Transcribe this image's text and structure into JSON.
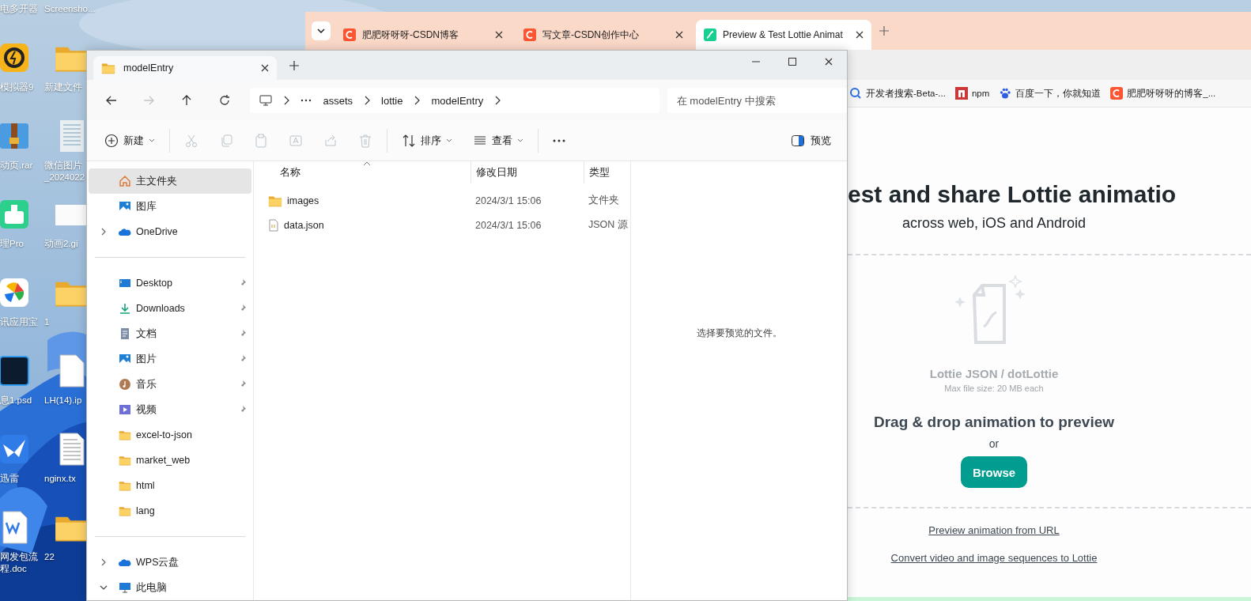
{
  "desktop": {
    "icons": [
      {
        "label": "电多开器",
        "kind": "none"
      },
      {
        "label": "Screensho...",
        "kind": "none"
      },
      {
        "label": "模拟器9",
        "kind": "emulator"
      },
      {
        "label": "新建文件",
        "kind": "folder"
      },
      {
        "label": "动页.rar",
        "kind": "archive"
      },
      {
        "label": "微信图片\n_2024022",
        "kind": "textimage"
      },
      {
        "label": "理Pro",
        "kind": "cleaner"
      },
      {
        "label": "动画2.gi",
        "kind": "blank"
      },
      {
        "label": "讯应用宝",
        "kind": "store"
      },
      {
        "label": "1",
        "kind": "folder"
      },
      {
        "label": "息1.psd",
        "kind": "psd"
      },
      {
        "label": "LH(14).ip",
        "kind": "file"
      },
      {
        "label": "迅雷",
        "kind": "bird"
      },
      {
        "label": "nginx.tx",
        "kind": "textfile"
      },
      {
        "label": "网发包流程.doc",
        "kind": "doc"
      },
      {
        "label": "22",
        "kind": "folder"
      }
    ]
  },
  "browser": {
    "tabs": [
      {
        "title": "肥肥呀呀呀-CSDN博客",
        "kind": "csdn",
        "selected": false
      },
      {
        "title": "写文章-CSDN创作中心",
        "kind": "csdn",
        "selected": false
      },
      {
        "title": "Preview & Test Lottie Animat",
        "kind": "lottie",
        "selected": true
      }
    ],
    "bookmarks": [
      {
        "label": "开发者搜索-Beta-...",
        "kind": "search"
      },
      {
        "label": "npm",
        "kind": "npm"
      },
      {
        "label": "百度一下，你就知道",
        "kind": "paw"
      },
      {
        "label": "肥肥呀呀呀的博客_...",
        "kind": "csdn"
      }
    ],
    "page": {
      "heading": "est and share Lottie animatio",
      "subheading": "across web, iOS and Android",
      "drop_title": "Lottie JSON / dotLottie",
      "drop_note": "Max file size: 20 MB each",
      "drag_text": "Drag & drop animation to preview",
      "or_text": "or",
      "browse_button": "Browse",
      "links": [
        "Preview animation from URL",
        "Convert video and image sequences to Lottie"
      ]
    }
  },
  "explorer": {
    "tab": "modelEntry",
    "nav": [
      {
        "kind": "back",
        "disabled": false
      },
      {
        "kind": "forward",
        "disabled": true
      },
      {
        "kind": "up",
        "disabled": false
      },
      {
        "kind": "refresh",
        "disabled": false
      }
    ],
    "breadcrumb": [
      "assets",
      "lottie",
      "modelEntry"
    ],
    "search": {
      "placeholder": "在 modelEntry 中搜索"
    },
    "commands": [
      {
        "kind": "new",
        "label": "新建",
        "disabled": false
      },
      {
        "kind": "cut",
        "disabled": true
      },
      {
        "kind": "copy",
        "disabled": true
      },
      {
        "kind": "paste",
        "disabled": true
      },
      {
        "kind": "rename",
        "disabled": true
      },
      {
        "kind": "share",
        "disabled": true
      },
      {
        "kind": "delete",
        "disabled": true
      },
      {
        "kind": "sort",
        "label": "排序",
        "disabled": false
      },
      {
        "kind": "view",
        "label": "查看",
        "disabled": false
      },
      {
        "kind": "more",
        "disabled": false
      }
    ],
    "preview_button": "预览",
    "sidebar": [
      {
        "items": [
          {
            "label": "主文件夹",
            "kind": "home",
            "selected": true,
            "pinned": false,
            "expandable": false,
            "expanded": false
          },
          {
            "label": "图库",
            "kind": "gallery",
            "selected": false,
            "pinned": false,
            "expandable": false,
            "expanded": false
          },
          {
            "label": "OneDrive",
            "kind": "cloud",
            "selected": false,
            "pinned": false,
            "expandable": true,
            "expanded": false
          }
        ]
      },
      {
        "items": [
          {
            "label": "Desktop",
            "kind": "desktop",
            "selected": false,
            "pinned": true,
            "expandable": false,
            "expanded": false
          },
          {
            "label": "Downloads",
            "kind": "download",
            "selected": false,
            "pinned": true,
            "expandable": false,
            "expanded": false
          },
          {
            "label": "文档",
            "kind": "document",
            "selected": false,
            "pinned": true,
            "expandable": false,
            "expanded": false
          },
          {
            "label": "图片",
            "kind": "gallery",
            "selected": false,
            "pinned": true,
            "expandable": false,
            "expanded": false
          },
          {
            "label": "音乐",
            "kind": "music",
            "selected": false,
            "pinned": true,
            "expandable": false,
            "expanded": false
          },
          {
            "label": "视频",
            "kind": "video",
            "selected": false,
            "pinned": true,
            "expandable": false,
            "expanded": false
          },
          {
            "label": "excel-to-json",
            "kind": "folder",
            "selected": false,
            "pinned": false,
            "expandable": false,
            "expanded": false
          },
          {
            "label": "market_web",
            "kind": "folder",
            "selected": false,
            "pinned": false,
            "expandable": false,
            "expanded": false
          },
          {
            "label": "html",
            "kind": "folder",
            "selected": false,
            "pinned": false,
            "expandable": false,
            "expanded": false
          },
          {
            "label": "lang",
            "kind": "folder",
            "selected": false,
            "pinned": false,
            "expandable": false,
            "expanded": false
          }
        ]
      },
      {
        "items": [
          {
            "label": "WPS云盘",
            "kind": "cloud",
            "selected": false,
            "pinned": false,
            "expandable": true,
            "expanded": false
          },
          {
            "label": "此电脑",
            "kind": "computer",
            "selected": false,
            "pinned": false,
            "expandable": true,
            "expanded": true
          }
        ]
      }
    ],
    "columns": [
      "名称",
      "修改日期",
      "类型"
    ],
    "rows": [
      {
        "kind": "folder",
        "name": "images",
        "modified": "2024/3/1 15:06",
        "type": "文件夹"
      },
      {
        "kind": "json",
        "name": "data.json",
        "modified": "2024/3/1 15:06",
        "type": "JSON 源"
      }
    ],
    "preview_message": "选择要预览的文件。"
  }
}
